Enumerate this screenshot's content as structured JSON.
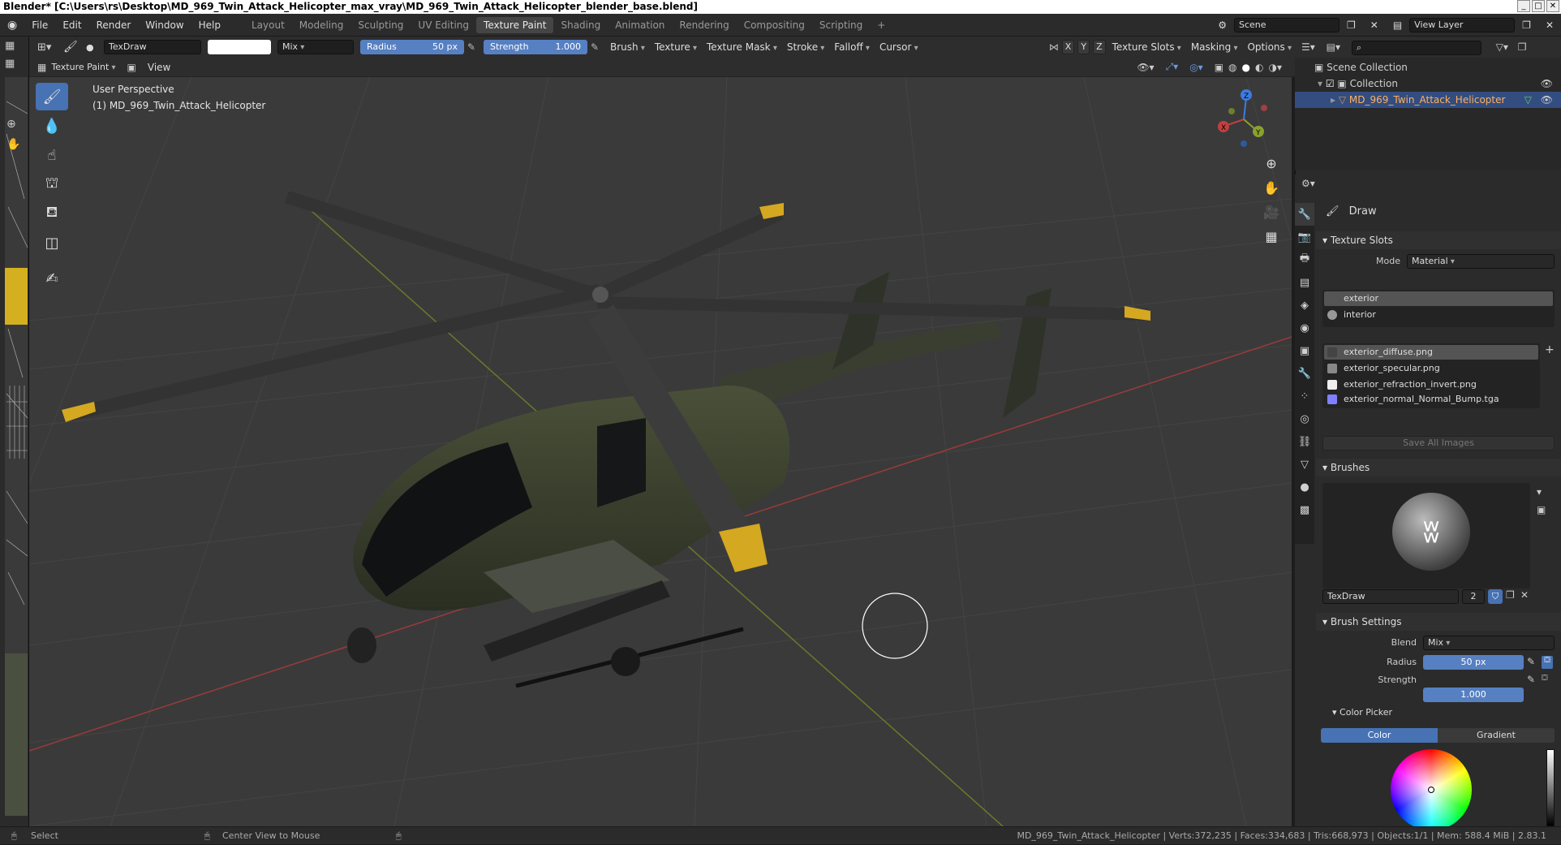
{
  "window": {
    "title": "Blender* [C:\\Users\\rs\\Desktop\\MD_969_Twin_Attack_Helicopter_max_vray\\MD_969_Twin_Attack_Helicopter_blender_base.blend]"
  },
  "menu": [
    "File",
    "Edit",
    "Render",
    "Window",
    "Help"
  ],
  "workspaces": [
    "Layout",
    "Modeling",
    "Sculpting",
    "UV Editing",
    "Texture Paint",
    "Shading",
    "Animation",
    "Rendering",
    "Compositing",
    "Scripting"
  ],
  "active_workspace": "Texture Paint",
  "scene": {
    "label": "Scene",
    "view_layer": "View Layer"
  },
  "tool_header": {
    "brush_name": "TexDraw",
    "blend": "Mix",
    "radius_label": "Radius",
    "radius_value": "50 px",
    "strength_label": "Strength",
    "strength_value": "1.000",
    "menus": [
      "Brush",
      "Texture",
      "Texture Mask",
      "Stroke",
      "Falloff",
      "Cursor"
    ],
    "axes": [
      "X",
      "Y",
      "Z"
    ],
    "right_menus": [
      "Texture Slots",
      "Masking",
      "Options"
    ]
  },
  "mode_header": {
    "mode": "Texture Paint",
    "view": "View"
  },
  "viewport": {
    "perspective": "User Perspective",
    "object": "(1) MD_969_Twin_Attack_Helicopter"
  },
  "outliner": {
    "scene_collection": "Scene Collection",
    "collection": "Collection",
    "object": "MD_969_Twin_Attack_Helicopter"
  },
  "properties": {
    "tool_name": "Draw",
    "texture_slots": {
      "header": "Texture Slots",
      "mode_label": "Mode",
      "mode_value": "Material",
      "materials": [
        "exterior",
        "interior"
      ],
      "images": [
        "exterior_diffuse.png",
        "exterior_specular.png",
        "exterior_refraction_invert.png",
        "exterior_normal_Normal_Bump.tga"
      ],
      "save_all": "Save All Images"
    },
    "brushes": {
      "header": "Brushes",
      "name": "TexDraw",
      "users": "2"
    },
    "brush_settings": {
      "header": "Brush Settings",
      "blend_label": "Blend",
      "blend_value": "Mix",
      "radius_label": "Radius",
      "radius_value": "50 px",
      "strength_label": "Strength",
      "strength_value": "1.000"
    },
    "color_picker": {
      "header": "Color Picker",
      "tabs": [
        "Color",
        "Gradient"
      ]
    }
  },
  "statusbar": {
    "select": "Select",
    "center": "Center View to Mouse",
    "stats": "MD_969_Twin_Attack_Helicopter | Verts:372,235 | Faces:334,683 | Tris:668,973 | Objects:1/1 | Mem: 588.4 MiB | 2.83.1"
  },
  "colors": {
    "accent": "#4772b3",
    "slider": "#5680c2",
    "x_axis": "#c04040",
    "y_axis": "#8aa030",
    "z_axis": "#3d7be0"
  }
}
